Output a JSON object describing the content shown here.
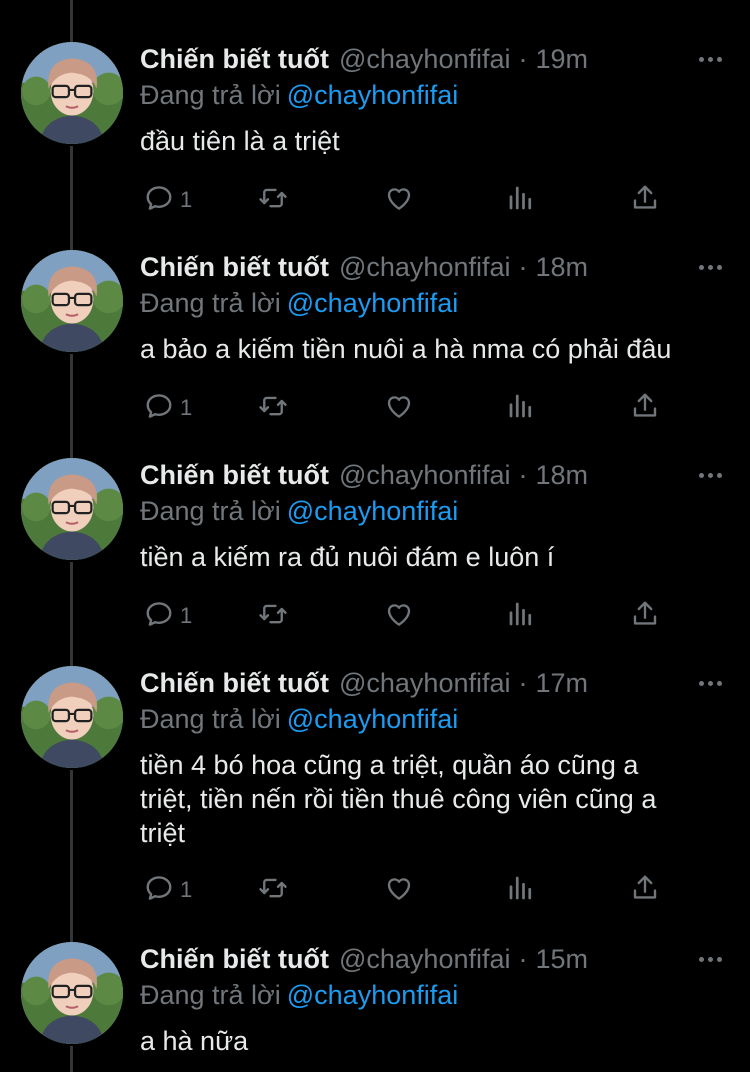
{
  "colors": {
    "background": "#000000",
    "text": "#e7e9ea",
    "secondary": "#71767b",
    "accent": "#1d9bf0"
  },
  "reply_prefix": "Đang trả lời",
  "icons": {
    "reply": "reply-icon",
    "retweet": "retweet-icon",
    "like": "heart-icon",
    "views": "views-icon",
    "share": "share-icon",
    "more": "more-icon"
  },
  "tweets": [
    {
      "name": "Chiến biết tuốt",
      "handle": "@chayhonfifai",
      "sep": "·",
      "time": "19m",
      "reply_to": "@chayhonfifai",
      "text": "đầu tiên là a triệt",
      "reply_count": "1"
    },
    {
      "name": "Chiến biết tuốt",
      "handle": "@chayhonfifai",
      "sep": "·",
      "time": "18m",
      "reply_to": "@chayhonfifai",
      "text": "a bảo a kiếm tiền nuôi a hà nma có phải đâu",
      "reply_count": "1"
    },
    {
      "name": "Chiến biết tuốt",
      "handle": "@chayhonfifai",
      "sep": "·",
      "time": "18m",
      "reply_to": "@chayhonfifai",
      "text": "tiền a kiếm ra đủ nuôi đám e luôn í",
      "reply_count": "1"
    },
    {
      "name": "Chiến biết tuốt",
      "handle": "@chayhonfifai",
      "sep": "·",
      "time": "17m",
      "reply_to": "@chayhonfifai",
      "text": "tiền 4 bó hoa cũng a triệt, quần áo cũng a\ntriệt, tiền nến rồi tiền thuê công viên cũng a\ntriệt",
      "reply_count": "1"
    },
    {
      "name": "Chiến biết tuốt",
      "handle": "@chayhonfifai",
      "sep": "·",
      "time": "15m",
      "reply_to": "@chayhonfifai",
      "text": "a hà nữa",
      "reply_count": ""
    }
  ]
}
